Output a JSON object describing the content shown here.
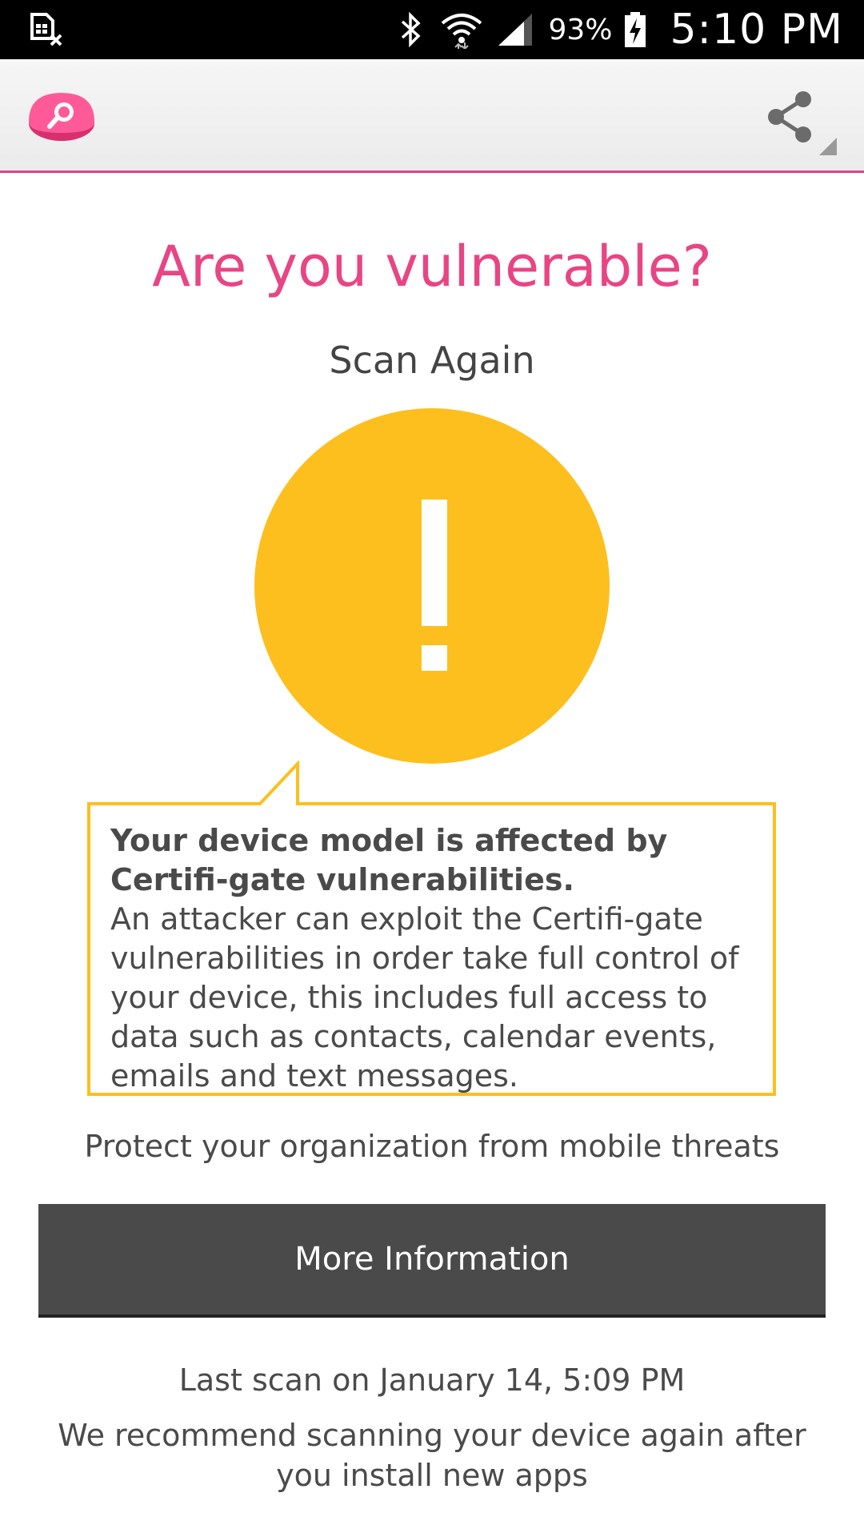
{
  "status_bar": {
    "notification_icon": "sim-card-x-icon",
    "bluetooth_icon": "bluetooth-icon",
    "wifi_icon": "wifi-icon",
    "signal_icon": "cell-signal-icon",
    "battery_icon": "battery-charging-icon",
    "battery_percent": "93%",
    "time": "5:10 PM"
  },
  "app_bar": {
    "logo_icon": "magnifier-logo-icon",
    "share_icon": "share-icon",
    "accent_color": "#e53f83"
  },
  "main": {
    "title": "Are you vulnerable?",
    "scan_again_label": "Scan Again",
    "warning_icon": "exclamation-icon",
    "warning_color": "#fdbf1e",
    "callout_heading": "Your device model is affected by Certifi-gate vulnerabilities.",
    "callout_body": "An attacker can exploit the Certifi-gate vulnerabilities in order take full control of your device, this includes full access to data such as contacts, calendar events, emails and text messages.",
    "protect_text": "Protect your organization from mobile threats",
    "more_info_label": "More Information",
    "last_scan": "Last scan on January 14, 5:09 PM",
    "recommend": "We recommend scanning your device again after you install new apps"
  }
}
